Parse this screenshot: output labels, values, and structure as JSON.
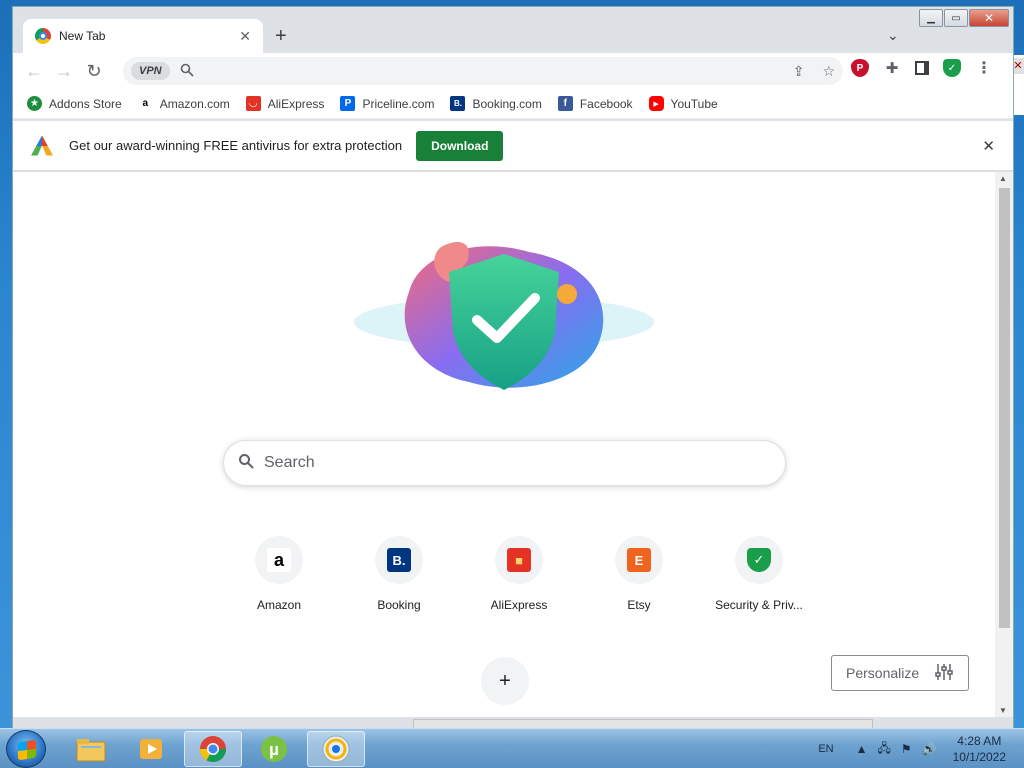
{
  "browser": {
    "tab": {
      "title": "New Tab"
    },
    "omnibox": {
      "vpn_label": "VPN",
      "value": ""
    },
    "bookmarks": [
      {
        "label": "Addons Store",
        "icon": "star-badge-icon",
        "color": "#1e8e3e"
      },
      {
        "label": "Amazon.com",
        "icon": "amazon-icon",
        "color": "#000000"
      },
      {
        "label": "AliExpress",
        "icon": "aliexpress-icon",
        "color": "#e43225"
      },
      {
        "label": "Priceline.com",
        "icon": "priceline-icon",
        "color": "#0068ef"
      },
      {
        "label": "Booking.com",
        "icon": "booking-icon",
        "color": "#003580"
      },
      {
        "label": "Facebook",
        "icon": "facebook-icon",
        "color": "#3b5998"
      },
      {
        "label": "YouTube",
        "icon": "youtube-icon",
        "color": "#ff0000"
      }
    ],
    "infobar": {
      "message": "Get our award-winning FREE antivirus for extra protection",
      "button_label": "Download"
    }
  },
  "newtab": {
    "search_placeholder": "Search",
    "shortcuts": [
      {
        "label": "Amazon",
        "glyph": "a",
        "color": "#ffffff",
        "text_color": "#000000"
      },
      {
        "label": "Booking",
        "glyph": "B.",
        "color": "#003580",
        "text_color": "#ffffff"
      },
      {
        "label": "AliExpress",
        "glyph": "■",
        "color": "#e43225",
        "text_color": "#ffd166"
      },
      {
        "label": "Etsy",
        "glyph": "E",
        "color": "#f1641e",
        "text_color": "#ffffff"
      },
      {
        "label": "Security & Priv...",
        "glyph": "✓",
        "color": "#1b9e4b",
        "text_color": "#ffffff"
      }
    ],
    "add_label": "+",
    "personalize_label": "Personalize"
  },
  "taskbar": {
    "language": "EN",
    "time": "4:28 AM",
    "date": "10/1/2022"
  }
}
